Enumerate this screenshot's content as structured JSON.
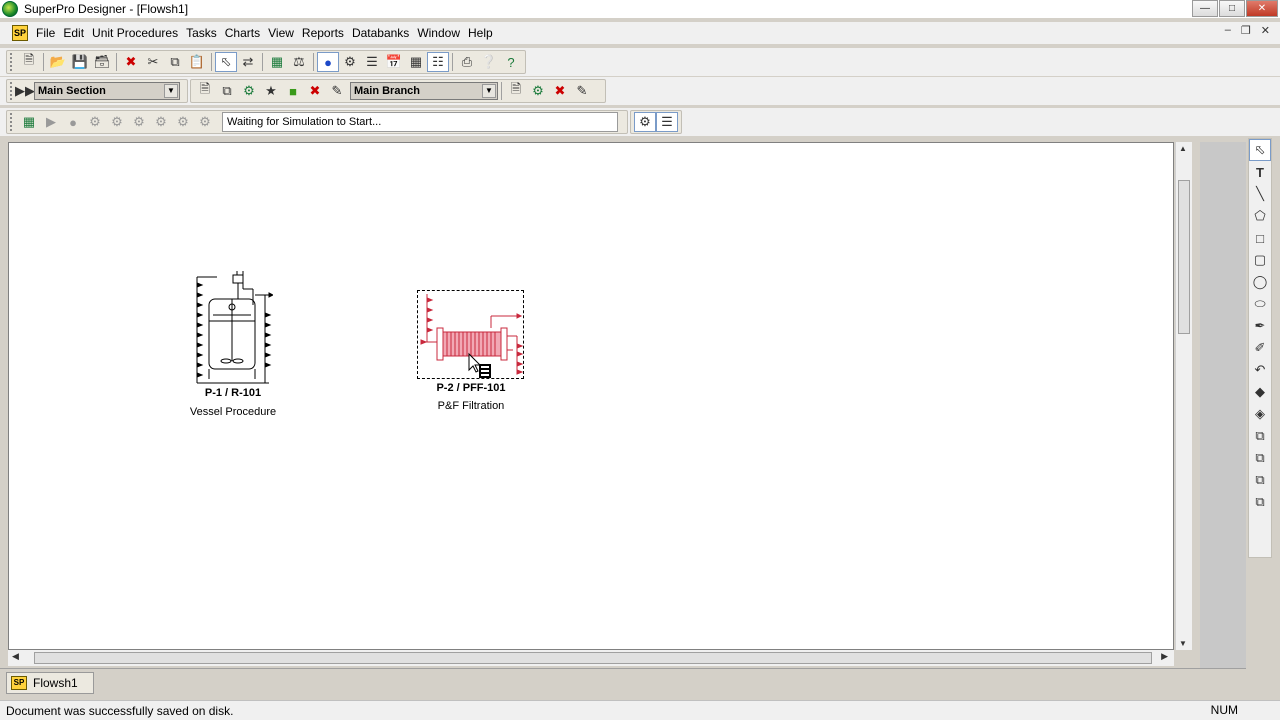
{
  "app": {
    "title": "SuperPro Designer - [Flowsh1]"
  },
  "menu": {
    "items": [
      "File",
      "Edit",
      "Unit Procedures",
      "Tasks",
      "Charts",
      "View",
      "Reports",
      "Databanks",
      "Window",
      "Help"
    ]
  },
  "toolbar2": {
    "section_combo": "Main Section",
    "branch_combo": "Main Branch"
  },
  "toolbar3": {
    "simulation_status": "Waiting for Simulation to Start..."
  },
  "flowsheet": {
    "units": [
      {
        "id": "P-1 / R-101",
        "name": "Vessel Procedure",
        "color": "#000000"
      },
      {
        "id": "P-2 / PFF-101",
        "name": "P&F Filtration",
        "color": "#c8283c"
      }
    ]
  },
  "tabs": [
    {
      "label": "Flowsh1"
    }
  ],
  "status": {
    "message": "Document was successfully saved on disk.",
    "num": "NUM"
  },
  "colors": {
    "filter_unit": "#c8283c",
    "background": "#d4d0c8"
  }
}
